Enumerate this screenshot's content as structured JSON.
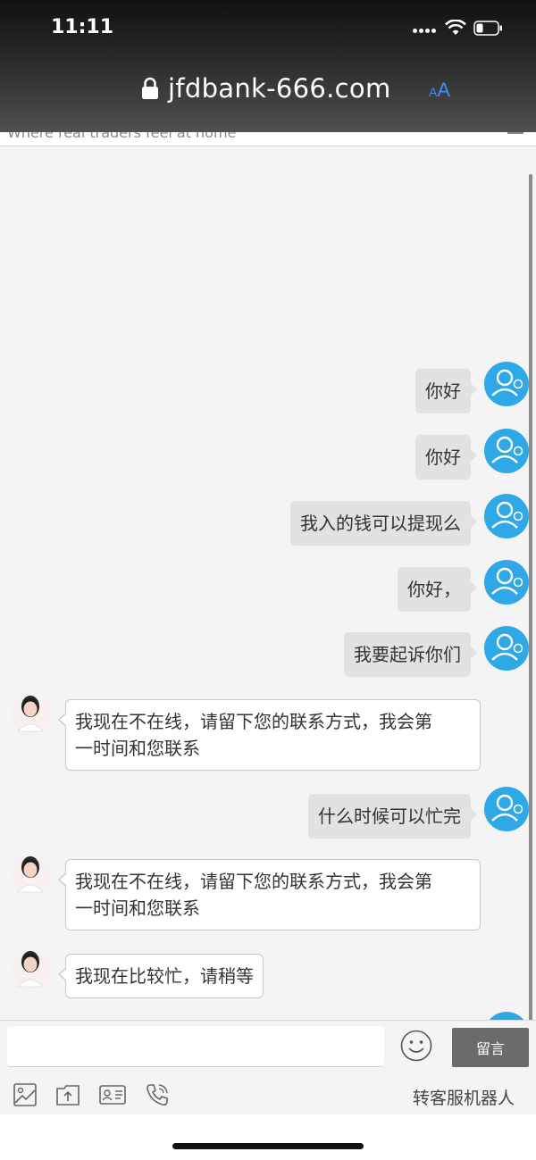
{
  "status_bar": {
    "time": "11:11"
  },
  "browser": {
    "url": "jfdbank-666.com",
    "text_size_small": "A",
    "text_size_large": "A"
  },
  "site": {
    "tagline": "Where real traders feel at home"
  },
  "messages": [
    {
      "from": "user",
      "text": "你好"
    },
    {
      "from": "user",
      "text": "你好"
    },
    {
      "from": "user",
      "text": "我入的钱可以提现么"
    },
    {
      "from": "user",
      "text": "你好，"
    },
    {
      "from": "user",
      "text": "我要起诉你们"
    },
    {
      "from": "agent",
      "lines": [
        "我现在不在线，请留下您的联系方式，我会第",
        "一时间和您联系"
      ]
    },
    {
      "from": "user",
      "text": "什么时候可以忙完"
    },
    {
      "from": "agent",
      "lines": [
        "我现在不在线，请留下您的联系方式，我会第",
        "一时间和您联系"
      ]
    },
    {
      "from": "agent",
      "lines": [
        "我现在比较忙，请稍等"
      ]
    }
  ],
  "input": {
    "value": "",
    "placeholder": ""
  },
  "send_button": {
    "label": "留言"
  },
  "toolbar": {
    "icons": [
      "image-icon",
      "upload-file-icon",
      "contact-card-icon",
      "phone-call-icon"
    ],
    "transfer_label": "转客服机器人"
  },
  "colors": {
    "user_avatar": "#2ea8e6",
    "send_button": "#6b6b6b",
    "text_size_button": "#3d8ef5"
  }
}
